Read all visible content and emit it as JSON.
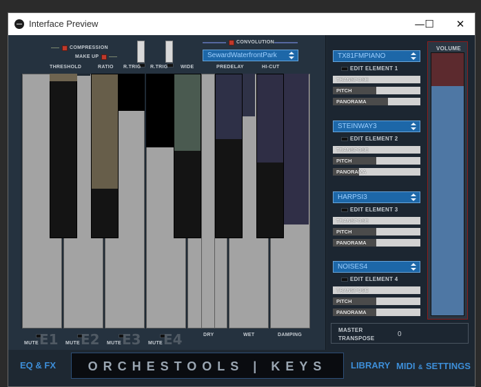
{
  "window": {
    "title": "Interface Preview",
    "controls": {
      "minimize": "—",
      "maximize": "☐",
      "close": "✕"
    }
  },
  "fx": {
    "compression": "COMPRESSION",
    "makeup": "MAKE UP",
    "convolution": "CONVOLUTION",
    "convolution_preset": "SewardWaterfrontPark",
    "knobs": [
      "THRESHOLD",
      "RATIO",
      "R.TRIG",
      "R.TRIG",
      "WIDE",
      "PREDELAY",
      "HI-CUT"
    ],
    "bottom_labels": [
      "DRY",
      "WET",
      "DAMPING"
    ]
  },
  "mutes": [
    {
      "label": "MUTE",
      "note": "E1"
    },
    {
      "label": "MUTE",
      "note": "E2"
    },
    {
      "label": "MUTE",
      "note": "E3"
    },
    {
      "label": "MUTE",
      "note": "E4"
    }
  ],
  "elements": [
    {
      "preset": "TX81FMPIANO",
      "edit": "EDIT ELEMENT 1",
      "params": [
        {
          "name": "TRANSPOSE",
          "value": 0.0
        },
        {
          "name": "PITCH",
          "value": 0.5
        },
        {
          "name": "PANORAMA",
          "value": 0.63
        }
      ]
    },
    {
      "preset": "STEINWAY3",
      "edit": "EDIT ELEMENT 2",
      "params": [
        {
          "name": "TRANSPOSE",
          "value": 0.0
        },
        {
          "name": "PITCH",
          "value": 0.5
        },
        {
          "name": "PANORAMA",
          "value": 0.3
        }
      ]
    },
    {
      "preset": "HARPSI3",
      "edit": "EDIT ELEMENT 3",
      "params": [
        {
          "name": "TRANSPOSE",
          "value": 0.0
        },
        {
          "name": "PITCH",
          "value": 0.5
        },
        {
          "name": "PANORAMA",
          "value": 0.5
        }
      ]
    },
    {
      "preset": "NOISES4",
      "edit": "EDIT ELEMENT 4",
      "params": [
        {
          "name": "TRANSPOSE",
          "value": 0.0
        },
        {
          "name": "PITCH",
          "value": 0.5
        },
        {
          "name": "PANORAMA",
          "value": 0.5
        }
      ]
    }
  ],
  "volume": {
    "label": "VOLUME",
    "level": 0.88
  },
  "master": {
    "label1": "MASTER",
    "label2": "TRANSPOSE",
    "value": "0"
  },
  "nav": {
    "eqfx": "EQ & FX",
    "logo": "ORCHESTOOLS | KEYS",
    "library": "LIBRARY",
    "midi": "MIDI",
    "amp": "&",
    "settings": "SETTINGS"
  },
  "colors": {
    "accent": "#3d8ed8",
    "select_bg": "#1d67a8",
    "led_red": "#c0392b",
    "volume_fill": "#4e77a4"
  }
}
